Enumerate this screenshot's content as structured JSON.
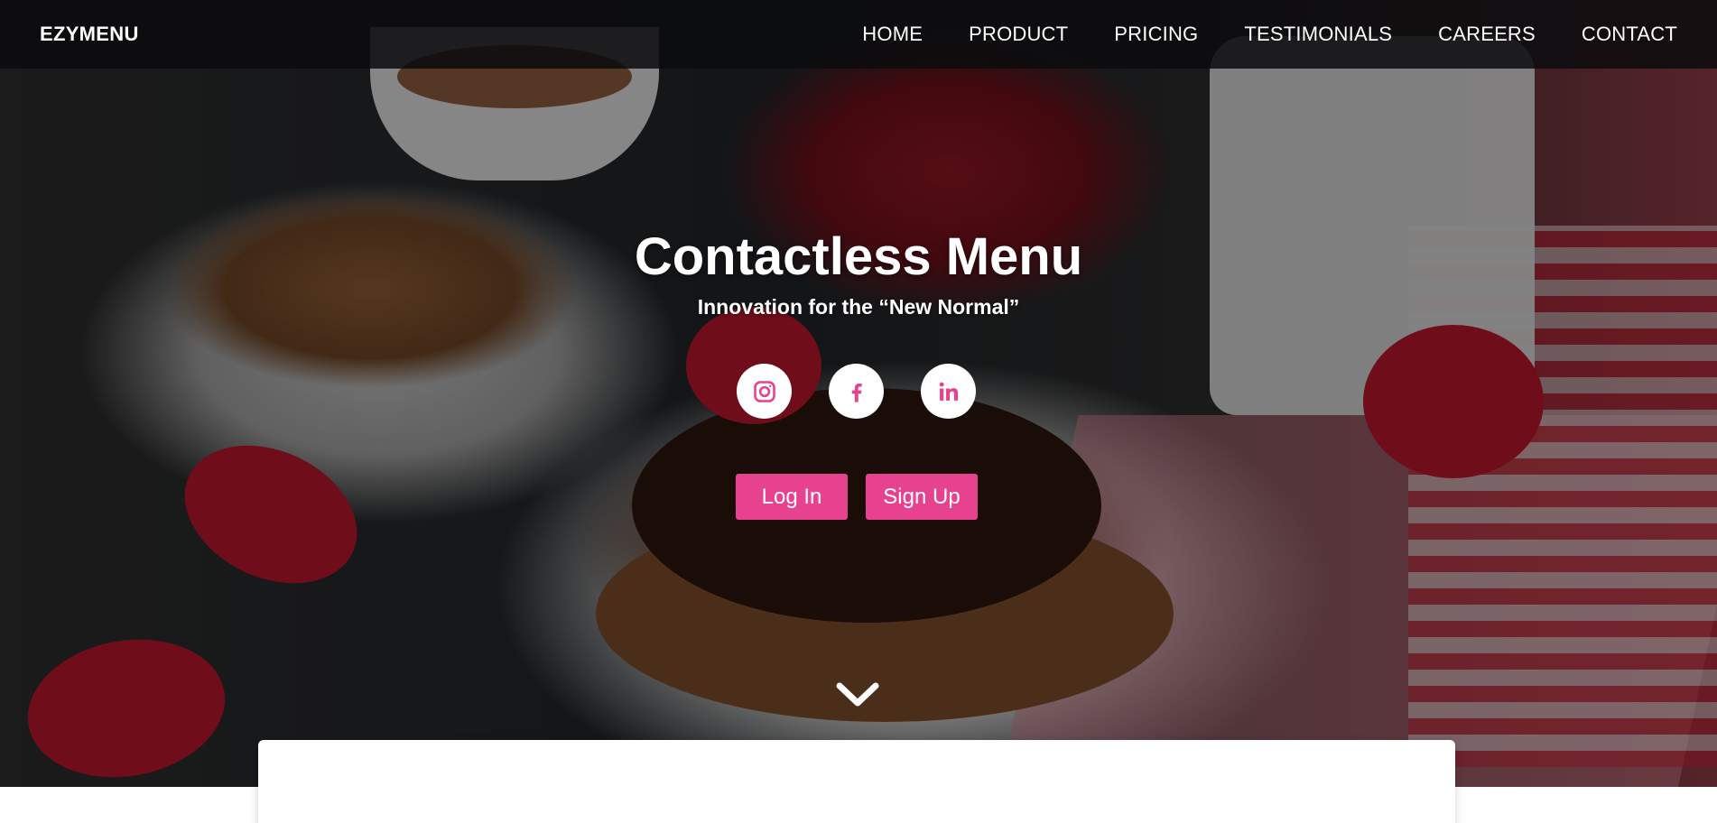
{
  "navbar": {
    "brand": "EZYMENU",
    "links": [
      "HOME",
      "PRODUCT",
      "PRICING",
      "TESTIMONIALS",
      "CAREERS",
      "CONTACT"
    ]
  },
  "hero": {
    "title": "Contactless Menu",
    "subtitle": "Innovation for the “New Normal”",
    "social_icons": [
      "instagram-icon",
      "facebook-icon",
      "linkedin-icon"
    ],
    "login_label": "Log In",
    "signup_label": "Sign Up",
    "scroll_icon": "chevron-down-icon"
  },
  "colors": {
    "accent": "#e6428f",
    "navbar_bg": "#0c0c0e",
    "text": "#ffffff"
  }
}
